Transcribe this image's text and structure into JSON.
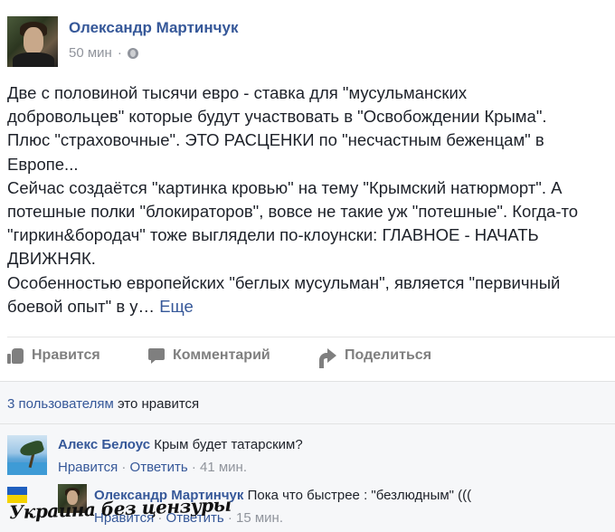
{
  "post": {
    "author": "Олександр Мартинчук",
    "time": "50 мин",
    "separator": "·",
    "privacy_icon": "globe-icon",
    "text_lines": [
      "Две с половиной тысячи евро - ставка для \"мусульманских",
      "добровольцев\" которые будут участвовать в \"Освобождении Крыма\".",
      "Плюс \"страховочные\". ЭТО РАСЦЕНКИ по \"несчастным беженцам\" в",
      "Европе...",
      "Сейчас создаётся \"картинка кровью\" на тему \"Крымский натюрморт\". А",
      "потешные полки \"блокираторов\", вовсе не такие уж \"потешные\". Когда-то",
      "\"гиркин&бородач\" тоже выглядели по-клоунски: ГЛАВНОЕ - НАЧАТЬ",
      "ДВИЖНЯК.",
      "Особенностью европейских \"беглых мусульман\", является \"первичный"
    ],
    "last_line": "боевой опыт\" в у…",
    "more_link": "Еще"
  },
  "actions": {
    "like": "Нравится",
    "comment": "Комментарий",
    "share": "Поделиться"
  },
  "likes": {
    "count_link": "3 пользователям",
    "suffix": " это нравится"
  },
  "comments": [
    {
      "author": "Алекс Белоус",
      "text": " Крым будет татарским?",
      "like": "Нравится",
      "dot": " · ",
      "reply": "Ответить",
      "time": "41 мин."
    },
    {
      "author": "Олександр Мартинчук",
      "text": " Пока что быстрее : \"безлюдным\" (((",
      "like": "Нравится",
      "dot": " · ",
      "reply": "Ответить",
      "time": "15 мин."
    }
  ],
  "watermark": {
    "text": "Украина без цензуры"
  },
  "colors": {
    "link": "#365899",
    "muted": "#90949c",
    "panel": "#f6f7f9"
  }
}
